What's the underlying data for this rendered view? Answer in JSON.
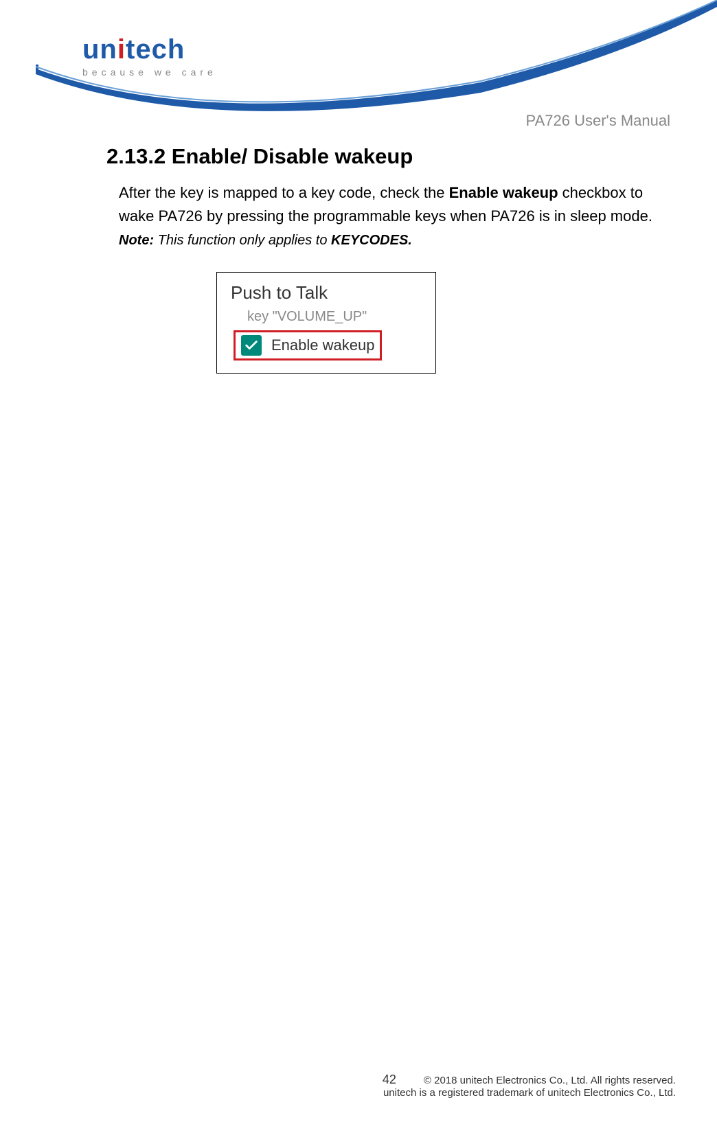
{
  "logo": {
    "name_part1": "un",
    "name_part2": "tech",
    "tagline": "because we care"
  },
  "header": {
    "title": "PA726 User's Manual"
  },
  "section": {
    "number_title": "2.13.2 Enable/ Disable wakeup",
    "body_pre": "After the key is mapped to a key code, check the ",
    "body_bold": "Enable wakeup",
    "body_post": " checkbox to wake PA726 by pressing the programmable keys when PA726 is in sleep mode. ",
    "note_label": "Note:",
    "note_text": " This function only applies to ",
    "note_bold": "KEYCODES."
  },
  "inner": {
    "title": "Push to Talk",
    "key_label": "key \"VOLUME_UP\"",
    "checkbox_label": "Enable wakeup",
    "checked": true
  },
  "footer": {
    "page": "42",
    "line1": "© 2018 unitech Electronics Co., Ltd. All rights reserved.",
    "line2": "unitech is a registered trademark of unitech Electronics Co., Ltd."
  }
}
